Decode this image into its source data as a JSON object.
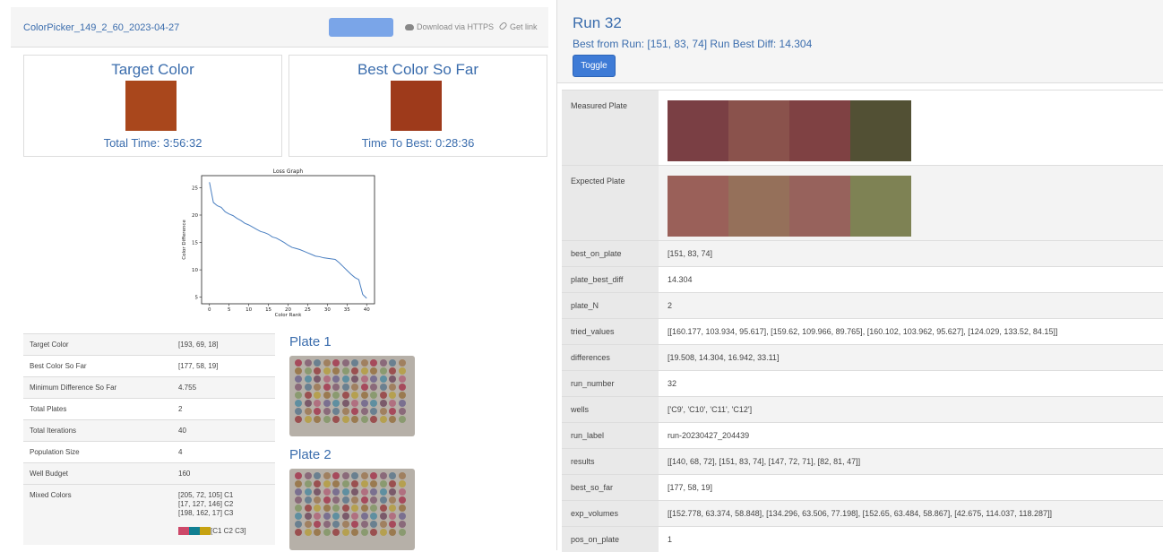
{
  "left": {
    "title": "ColorPicker_149_2_60_2023-04-27",
    "download_label": "Download via HTTPS",
    "getlink_label": "Get link",
    "target": {
      "heading": "Target Color",
      "swatch": "#a9471c",
      "footer": "Total Time: 3:56:32"
    },
    "best": {
      "heading": "Best Color So Far",
      "swatch": "#9e3a1b",
      "footer": "Time To Best: 0:28:36"
    },
    "stats": [
      {
        "k": "Target Color",
        "v": "[193, 69, 18]"
      },
      {
        "k": "Best Color So Far",
        "v": "[177, 58, 19]"
      },
      {
        "k": "Minimum Difference So Far",
        "v": "4.755"
      },
      {
        "k": "Total Plates",
        "v": "2"
      },
      {
        "k": "Total Iterations",
        "v": "40"
      },
      {
        "k": "Population Size",
        "v": "4"
      },
      {
        "k": "Well Budget",
        "v": "160"
      }
    ],
    "mixed": {
      "k": "Mixed Colors",
      "lines": [
        "[205, 72, 105] C1",
        "[17, 127, 146] C2",
        "[198, 162, 17] C3"
      ],
      "legend_label": "[C1 C2 C3]",
      "legend_colors": [
        "#cd4869",
        "#117f92",
        "#c6a211"
      ]
    },
    "plate1": "Plate 1",
    "plate2": "Plate 2"
  },
  "chart_data": {
    "type": "line",
    "title": "Loss Graph",
    "xlabel": "Color Rank",
    "ylabel": "Color Difference",
    "xlim": [
      -2,
      42
    ],
    "ylim": [
      3.8,
      27.2
    ],
    "xticks": [
      0,
      5,
      10,
      15,
      20,
      25,
      30,
      35,
      40
    ],
    "yticks": [
      5,
      10,
      15,
      20,
      25
    ],
    "x": [
      0,
      1,
      2,
      3,
      4,
      5,
      6,
      7,
      8,
      9,
      10,
      11,
      12,
      13,
      14,
      15,
      16,
      17,
      18,
      19,
      20,
      21,
      22,
      23,
      24,
      25,
      26,
      27,
      28,
      29,
      30,
      31,
      32,
      33,
      34,
      35,
      36,
      37,
      38,
      39,
      40
    ],
    "values": [
      26.0,
      22.3,
      21.7,
      21.4,
      20.6,
      20.2,
      19.9,
      19.4,
      19.0,
      18.5,
      18.2,
      17.8,
      17.4,
      17.0,
      16.8,
      16.5,
      16.0,
      15.8,
      15.4,
      15.0,
      14.5,
      14.1,
      13.9,
      13.7,
      13.4,
      13.1,
      12.8,
      12.5,
      12.4,
      12.2,
      12.1,
      12.0,
      11.9,
      11.3,
      10.6,
      9.9,
      9.2,
      8.6,
      8.2,
      5.5,
      4.8
    ],
    "color": "#4a7fc1",
    "grid": false
  },
  "right": {
    "title": "Run 32",
    "best_line": "Best from Run: [151, 83, 74] Run Best Diff: 14.304",
    "toggle_label": "Toggle",
    "measured_label": "Measured Plate",
    "measured_colors": [
      "#7a3f44",
      "#8a524c",
      "#7f4143",
      "#525034"
    ],
    "expected_label": "Expected Plate",
    "expected_colors": [
      "#9a6059",
      "#95705a",
      "#97625c",
      "#7e8254"
    ],
    "rows": [
      {
        "k": "best_on_plate",
        "v": "[151, 83, 74]"
      },
      {
        "k": "plate_best_diff",
        "v": "14.304"
      },
      {
        "k": "plate_N",
        "v": "2"
      },
      {
        "k": "tried_values",
        "v": "[[160.177, 103.934, 95.617], [159.62, 109.966, 89.765], [160.102, 103.962, 95.627], [124.029, 133.52, 84.15]]"
      },
      {
        "k": "differences",
        "v": "[19.508, 14.304, 16.942, 33.11]"
      },
      {
        "k": "run_number",
        "v": "32"
      },
      {
        "k": "wells",
        "v": "['C9', 'C10', 'C11', 'C12']"
      },
      {
        "k": "run_label",
        "v": "run-20230427_204439"
      },
      {
        "k": "results",
        "v": "[[140, 68, 72], [151, 83, 74], [147, 72, 71], [82, 81, 47]]"
      },
      {
        "k": "best_so_far",
        "v": "[177, 58, 19]"
      },
      {
        "k": "exp_volumes",
        "v": "[[152.778, 63.374, 58.848], [134.296, 63.506, 77.198], [152.65, 63.484, 58.867], [42.675, 114.037, 118.287]]"
      },
      {
        "k": "pos_on_plate",
        "v": "1"
      }
    ]
  }
}
